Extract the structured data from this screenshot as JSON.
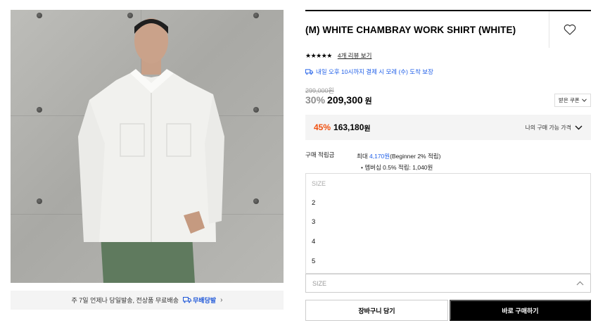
{
  "product": {
    "title": "(M) WHITE CHAMBRAY WORK SHIRT (WHITE)",
    "image_alt": "product-photo"
  },
  "icons": {
    "wishlist": "heart-outline-icon",
    "delivery": "truck-icon",
    "coupon_chevron": "chevron-down-icon",
    "best_chevron": "chevron-down-icon",
    "select_chevron": "chevron-up-icon",
    "shipping_link": "chevron-right-icon"
  },
  "shipping_bar": {
    "text": "주 7일 언제나 당일발송, 전상품 무료배송",
    "badge": "무배당발",
    "badge_color": "#1c55d8"
  },
  "rating": {
    "stars": "★★★★★",
    "reviews_label": "4개 리뷰 보기"
  },
  "delivery_notice": "내일 오후 10시까지 결제 시 모레 (수) 도착 보장",
  "price": {
    "original": "299,000원",
    "discount_pct": "30%",
    "sale": "209,300",
    "currency": "원",
    "coupon_button": "받은 쿠폰"
  },
  "best_price": {
    "discount_pct": "45%",
    "price": "163,180",
    "currency": "원",
    "link_label": "나의 구매 가능 가격",
    "accent_color": "#f0500f"
  },
  "points": {
    "label": "구매 적립금",
    "max_prefix": "최대 ",
    "max_amount": "4,170원",
    "max_suffix": "(Beginner 2% 적립)",
    "membership": "• 멤버십 0.5% 적립: 1,040원"
  },
  "size_dropdown": {
    "header": "SIZE",
    "options": [
      "2",
      "3",
      "4",
      "5"
    ]
  },
  "size_select": {
    "placeholder": "SIZE"
  },
  "actions": {
    "cart": "장바구니 담기",
    "buy": "바로 구매하기"
  }
}
